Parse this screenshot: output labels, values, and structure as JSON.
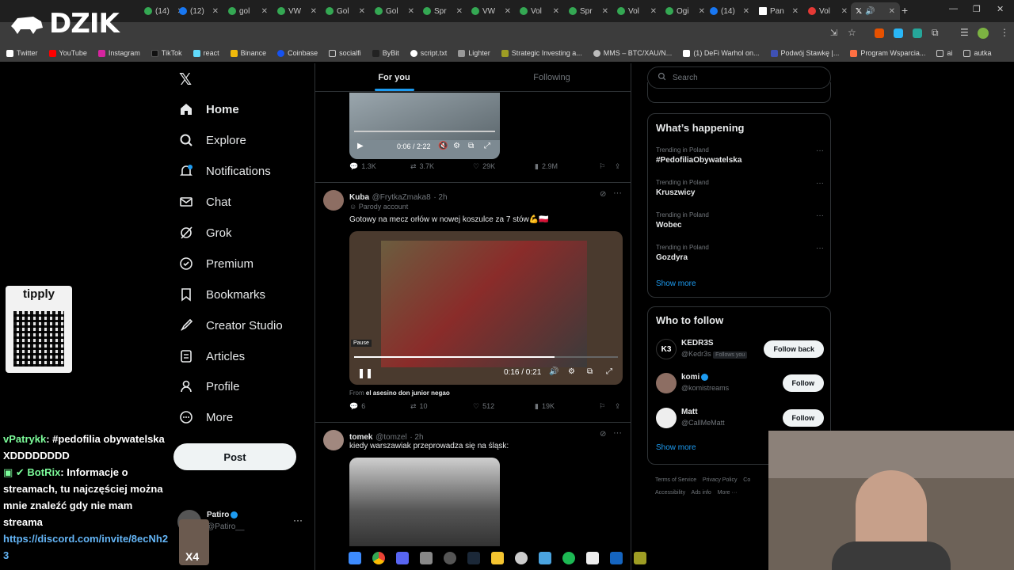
{
  "browser": {
    "tabs": [
      {
        "label": "(14)"
      },
      {
        "label": "(12)"
      },
      {
        "label": "gol"
      },
      {
        "label": "VW"
      },
      {
        "label": "Gol"
      },
      {
        "label": "Gol"
      },
      {
        "label": "Spr"
      },
      {
        "label": "VW"
      },
      {
        "label": "Vol"
      },
      {
        "label": "Spr"
      },
      {
        "label": "Vol"
      },
      {
        "label": "Ogi"
      },
      {
        "label": "(14)"
      },
      {
        "label": "Pan"
      },
      {
        "label": "Vol"
      },
      {
        "label": "X"
      }
    ],
    "bookmarks": [
      "Twitter",
      "YouTube",
      "Instagram",
      "TikTok",
      "react",
      "Binance",
      "Coinbase",
      "socialfi",
      "ByBit",
      "script.txt",
      "Lighter",
      "Strategic Investing a...",
      "MMS – BTC/XAU/N...",
      "(1) DeFi Warhol on...",
      "Podwój Stawkę |...",
      "Program Wsparcia...",
      "ai",
      "autka"
    ]
  },
  "overlay": {
    "logo": "DZIK"
  },
  "nav": {
    "items": [
      {
        "label": "Home",
        "icon": "home-icon"
      },
      {
        "label": "Explore",
        "icon": "search-icon"
      },
      {
        "label": "Notifications",
        "icon": "bell-icon"
      },
      {
        "label": "Chat",
        "icon": "mail-icon"
      },
      {
        "label": "Grok",
        "icon": "grok-icon"
      },
      {
        "label": "Premium",
        "icon": "premium-icon"
      },
      {
        "label": "Bookmarks",
        "icon": "bookmark-icon"
      },
      {
        "label": "Creator Studio",
        "icon": "rocket-icon"
      },
      {
        "label": "Articles",
        "icon": "article-icon"
      },
      {
        "label": "Profile",
        "icon": "person-icon"
      },
      {
        "label": "More",
        "icon": "more-icon"
      }
    ],
    "post_label": "Post",
    "account": {
      "name": "Patiro",
      "handle": "@Patiro__"
    }
  },
  "feed": {
    "tabs": [
      "For you",
      "Following"
    ],
    "post1": {
      "video_time": "0:06 / 2:22",
      "replies": "1.3K",
      "reposts": "3.7K",
      "likes": "29K",
      "views": "2.9M"
    },
    "post2": {
      "name": "Kuba",
      "handle": "@FrytkaZmaka8",
      "time": "· 2h",
      "badge": "Parody account",
      "text": "Gotowy na mecz orłów w nowej koszulce za 7 stów💪🇵🇱",
      "video_time": "0:16 / 0:21",
      "pause_label": "Pause",
      "from_prefix": "From",
      "from_name": "el asesino don junior negao",
      "replies": "6",
      "reposts": "10",
      "likes": "512",
      "views": "19K"
    },
    "post3": {
      "name": "tomek",
      "handle": "@tomzel",
      "time": "· 2h",
      "text": "kiedy warszawiak przeprowadza się na śląsk:"
    }
  },
  "sidebar": {
    "search_placeholder": "Search",
    "happening_title": "What’s happening",
    "trends": [
      {
        "category": "Trending in Poland",
        "title": "#PedofiliaObywatelska"
      },
      {
        "category": "Trending in Poland",
        "title": "Kruszwicy"
      },
      {
        "category": "Trending in Poland",
        "title": "Wobec"
      },
      {
        "category": "Trending in Poland",
        "title": "Gozdyra"
      }
    ],
    "show_more": "Show more",
    "wtf_title": "Who to follow",
    "follow": [
      {
        "name": "KEDR3S",
        "handle": "@Kedr3s",
        "note": "Follows you",
        "button": "Follow back",
        "avatar_text": "K3"
      },
      {
        "name": "komi",
        "handle": "@komistreams",
        "button": "Follow",
        "avatar_text": ""
      },
      {
        "name": "Matt",
        "handle": "@CallMeMatt",
        "button": "Follow",
        "avatar_text": ""
      }
    ],
    "footer": [
      "Terms of Service",
      "Privacy Policy",
      "Co",
      "Accessibility",
      "Ads info",
      "More ···"
    ]
  },
  "stream": {
    "tipply": "tipply",
    "chat": [
      {
        "user": "vPatrykk",
        "msg": ": #pedofilia obywatelska XDDDDDDDD"
      },
      {
        "user": "BotRix",
        "msg": ": Informacje o streamach, tu najczęściej można mnie znaleźć gdy nie mam streama"
      },
      {
        "user": "",
        "msg": "https://discord.com/invite/8ecNh23"
      }
    ],
    "x4": "X4"
  },
  "colors": {
    "accent": "#1d9bf0",
    "background": "#000000",
    "border": "#2f3336",
    "muted": "#71767b"
  }
}
